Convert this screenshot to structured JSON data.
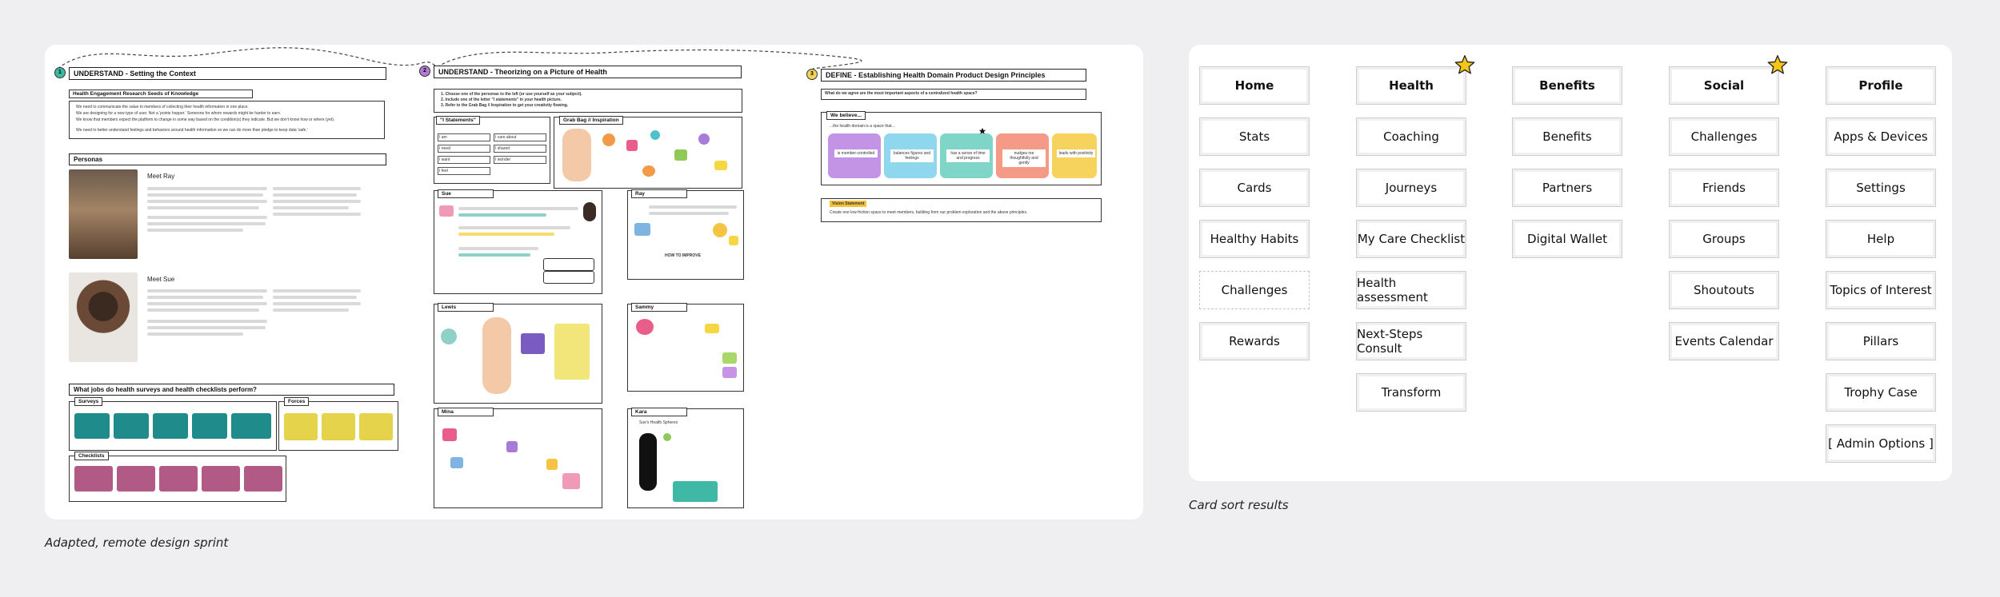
{
  "captions": {
    "sprint": "Adapted, remote design sprint",
    "card_sort": "Card sort results"
  },
  "sprint": {
    "understand_context": {
      "step": "1",
      "title": "UNDERSTAND - Setting the Context",
      "research_title": "Health Engagement Research Seeds of Knowledge",
      "bullets": [
        "We need to communicate the value to members of collecting their health information in one place",
        "We are designing for a new type of user. Not a 'points hopper.' Someone for whom rewards might be harder to earn.",
        "We know that members expect the platform to change in some way based on the condition(s) they indicate. But we don't know how or where (yet).",
        "We need to better understand feelings and behaviors around health information so we can do more than pledge to keep data 'safe.'"
      ],
      "personas_title": "Personas",
      "persona_1": "Meet Ray",
      "persona_2": "Meet Sue",
      "jobs_title": "What jobs do health surveys and health checklists perform?",
      "surveys_label": "Surveys",
      "forces_label": "Forces",
      "checklists_label": "Checklists"
    },
    "understand_picture": {
      "step": "2",
      "title": "UNDERSTAND - Theorizing on a Picture of Health",
      "instructions": [
        "1. Choose one of the personas to the left (or use yourself as your subject).",
        "2. Include one of the letter \"I statements\" in your health picture.",
        "3. Refer to the Grab Bag // Inspiration to get your creativity flowing."
      ],
      "i_statements_label": "\"I Statements\"",
      "i_statements": [
        "I am",
        "I care about",
        "I need",
        "I shared",
        "I want",
        "I wonder",
        "I feel"
      ],
      "grab_bag_label": "Grab Bag // Inspiration",
      "frames": [
        "Sue",
        "Ray",
        "Lewis",
        "Sammy",
        "Mina",
        "Kara"
      ],
      "how_to_improve": "HOW TO IMPROVE",
      "health_spheres": "Sue's Health Spheres"
    },
    "define": {
      "step": "3",
      "title": "DEFINE - Establishing Health Domain Product Design Principles",
      "question": "What do we agree are the most important aspects of a centralized health space?",
      "believe_label": "We believe...",
      "believe_sub": "...the health domain is a space that...",
      "principles": [
        "is member-controlled",
        "balances figures and feelings",
        "has a sense of time and progress",
        "nudges me thoughtfully and gently",
        "leads with positivity"
      ],
      "vision_label": "Vision Statement",
      "vision_text": "Create one low-friction space to meet members, building from our problem exploration and the above principles."
    }
  },
  "card_sort": {
    "columns": [
      {
        "header": "Home",
        "starred": false,
        "items": [
          "Stats",
          "Cards",
          "Healthy Habits",
          "Challenges",
          "Rewards"
        ],
        "dashed_index": 3
      },
      {
        "header": "Health",
        "starred": true,
        "items": [
          "Coaching",
          "Journeys",
          "My Care Checklist",
          "Health assessment",
          "Next-Steps Consult",
          "Transform"
        ],
        "dashed_index": -1
      },
      {
        "header": "Benefits",
        "starred": false,
        "items": [
          "Benefits",
          "Partners",
          "Digital Wallet"
        ],
        "dashed_index": -1
      },
      {
        "header": "Social",
        "starred": true,
        "items": [
          "Challenges",
          "Friends",
          "Groups",
          "Shoutouts",
          "Events Calendar"
        ],
        "dashed_index": -1
      },
      {
        "header": "Profile",
        "starred": false,
        "items": [
          "Apps & Devices",
          "Settings",
          "Help",
          "Topics of Interest",
          "Pillars",
          "Trophy Case",
          "[ Admin Options ]"
        ],
        "dashed_index": -1
      }
    ],
    "star_color": "#f5c518"
  }
}
